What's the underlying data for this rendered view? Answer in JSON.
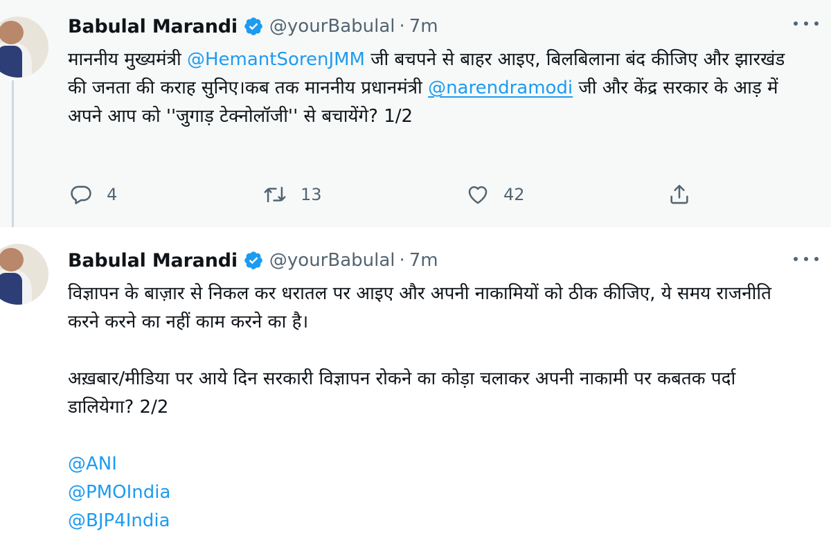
{
  "tweets": [
    {
      "author_name": "Babulal Marandi",
      "handle": "@yourBabulal",
      "separator": "·",
      "time": "7m",
      "text": {
        "part1": "माननीय मुख्यमंत्री ",
        "mention1": "@HemantSorenJMM",
        "part2": " जी बचपने से बाहर आइए, बिलबिलाना बंद कीजिए और झारखंड की जनता की कराह सुनिए।कब तक माननीय प्रधानमंत्री ",
        "mention2": "@narendramodi",
        "part3": " जी और केंद्र सरकार के आड़ में अपने आप को ''जुगाड़ टेक्नोलॉजी'' से बचायेंगे? 1/2"
      },
      "actions": {
        "reply_count": "4",
        "retweet_count": "13",
        "like_count": "42"
      }
    },
    {
      "author_name": "Babulal Marandi",
      "handle": "@yourBabulal",
      "separator": "·",
      "time": "7m",
      "text": {
        "para1": "विज्ञापन के बाज़ार से निकल कर धरातल पर आइए और अपनी नाकामियों को ठीक कीजिए, ये समय राजनीति करने करने का नहीं काम करने का है।",
        "para2": "अख़बार/मीडिया पर आये दिन सरकारी विज्ञापन रोकने का कोड़ा चलाकर अपनी नाकामी पर कबतक पर्दा डालियेगा? 2/2",
        "mentions": [
          "@ANI",
          "@PMOIndia",
          "@BJP4India"
        ]
      }
    }
  ],
  "icons": {
    "verified": "verified-badge-icon",
    "more": "more-dots-icon",
    "reply": "reply-icon",
    "retweet": "retweet-icon",
    "like": "like-icon",
    "share": "share-icon"
  },
  "colors": {
    "link": "#1d9bf0",
    "secondary_text": "#536471",
    "primary_text": "#0f1419",
    "first_tweet_background": "#f7f9f9",
    "thread_line": "#cfd9de"
  }
}
